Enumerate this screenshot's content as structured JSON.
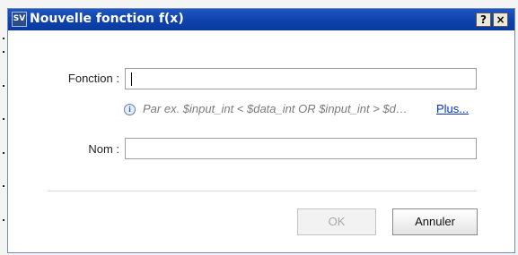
{
  "window": {
    "app_icon_text": "SV",
    "title": "Nouvelle fonction f(x)",
    "help_label": "?",
    "close_label": "×"
  },
  "form": {
    "function_label": "Fonction :",
    "function_value": "",
    "hint_icon": "info-icon",
    "hint_text": "Par ex. $input_int < $data_int OR $input_int > $data_int",
    "more_link": "Plus...",
    "name_label": "Nom :",
    "name_value": ""
  },
  "buttons": {
    "ok_label": "OK",
    "ok_state": "disabled",
    "cancel_label": "Annuler"
  },
  "colors": {
    "titlebar": "#0f43ae",
    "link": "#0033cc",
    "hint_text": "#7a7a7a"
  }
}
